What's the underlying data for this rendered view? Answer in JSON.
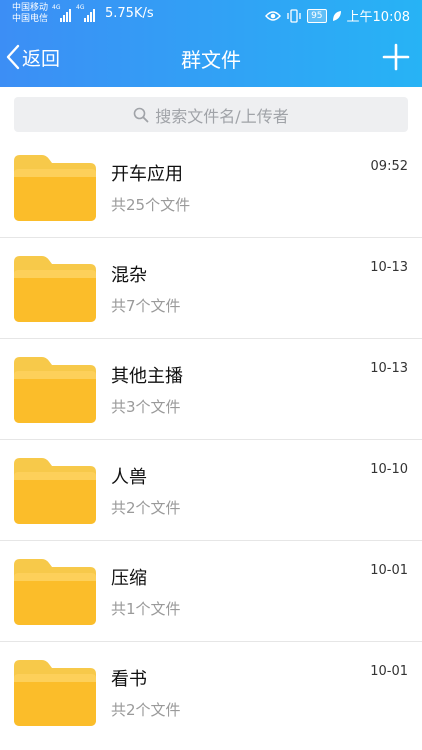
{
  "status_bar": {
    "carrier1": "中国移动",
    "carrier2": "中国电信",
    "sig1_label": "4G",
    "sig2_label": "4G",
    "speed": "5.75K/s",
    "battery": "95",
    "time": "上午10:08"
  },
  "nav": {
    "back_label": "返回",
    "title": "群文件",
    "add_icon": "plus-icon"
  },
  "search": {
    "placeholder": "搜索文件名/上传者",
    "icon": "search-icon"
  },
  "folders": [
    {
      "name": "开车应用",
      "count": "共25个文件",
      "time": "09:52"
    },
    {
      "name": "混杂",
      "count": "共7个文件",
      "time": "10-13"
    },
    {
      "name": "其他主播",
      "count": "共3个文件",
      "time": "10-13"
    },
    {
      "name": "人兽",
      "count": "共2个文件",
      "time": "10-10"
    },
    {
      "name": "压缩",
      "count": "共1个文件",
      "time": "10-01"
    },
    {
      "name": "看书",
      "count": "共2个文件",
      "time": "10-01"
    }
  ],
  "colors": {
    "header_start": "#3c8ef5",
    "header_end": "#27b3f5",
    "folder": "#fbbd2a"
  }
}
